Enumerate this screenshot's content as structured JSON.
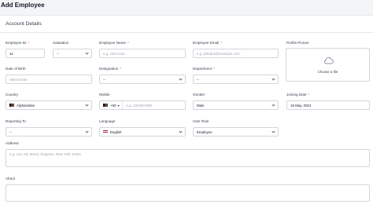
{
  "page": {
    "title": "Add Employee"
  },
  "section": {
    "title": "Account Details"
  },
  "fields": {
    "employee_id": {
      "label": "Employee ID",
      "value": "11"
    },
    "salutation": {
      "label": "Salutation",
      "value": "--"
    },
    "employee_name": {
      "label": "Employee Name",
      "placeholder": "e.g. John Doe"
    },
    "employee_email": {
      "label": "Employee Email",
      "placeholder": "e.g. johndoe@example.com"
    },
    "profile_picture": {
      "label": "Profile Picture",
      "upload_text": "Choose a file"
    },
    "date_of_birth": {
      "label": "Date of Birth",
      "placeholder": "Select Date"
    },
    "designation": {
      "label": "Designation",
      "value": "--"
    },
    "department": {
      "label": "Department",
      "value": "--"
    },
    "country": {
      "label": "Country",
      "value": "Afghanistan"
    },
    "mobile": {
      "label": "Mobile",
      "code": "+93",
      "placeholder": "e.g. 1234567890"
    },
    "gender": {
      "label": "Gender",
      "value": "Male"
    },
    "joining_date": {
      "label": "Joining Date",
      "value": "16 May, 2024"
    },
    "reporting_to": {
      "label": "Reporting To",
      "value": "--"
    },
    "language": {
      "label": "Language",
      "value": "English"
    },
    "user_role": {
      "label": "User Role",
      "value": "Employee"
    },
    "address": {
      "label": "Address",
      "placeholder": "e.g. 132, My Street, Kingston, New York 12401"
    },
    "about": {
      "label": "About"
    }
  },
  "required_marker": "*",
  "colors": {
    "required": "#ef4444",
    "border": "#d1d5db",
    "placeholder": "#9ca3af"
  },
  "icons": {
    "upload": "cloud-upload-icon",
    "dropdown": "chevron-down-icon"
  }
}
